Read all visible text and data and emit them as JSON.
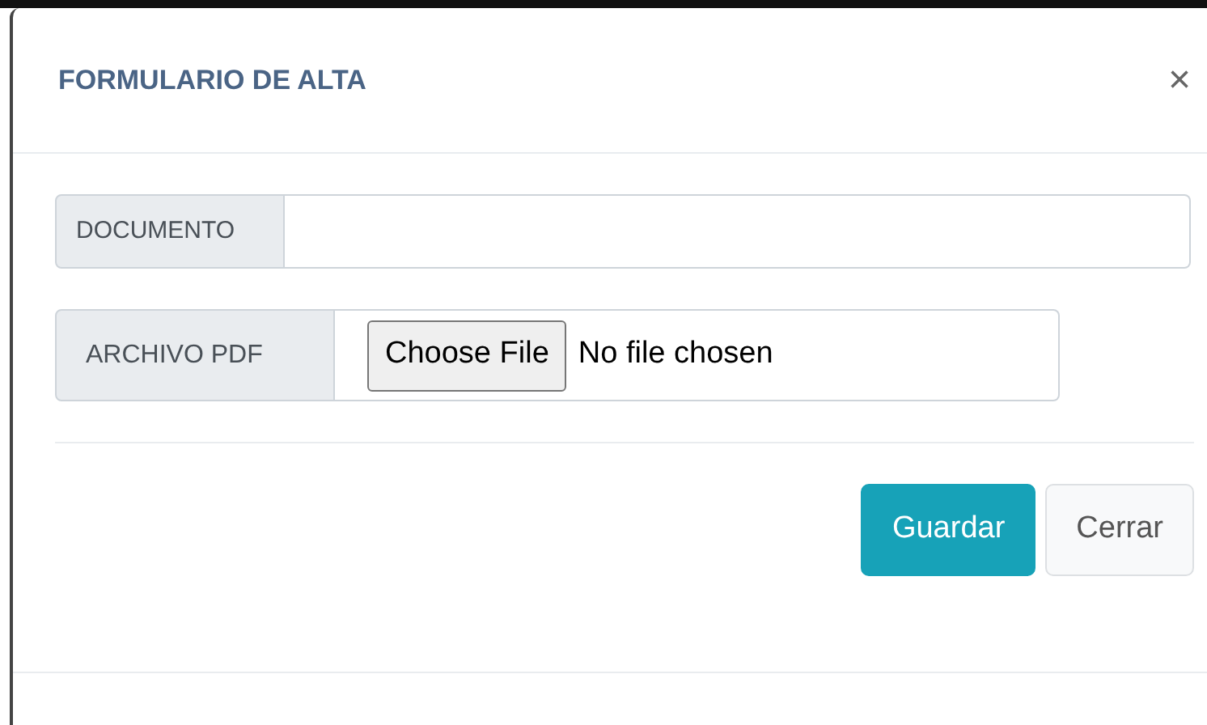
{
  "dialog": {
    "title": "FORMULARIO DE ALTA",
    "close": "×"
  },
  "fields": [
    {
      "kind": "text",
      "label": "DOCUMENTO"
    },
    {
      "kind": "file",
      "label": "ARCHIVO PDF",
      "button": "Choose File",
      "status": "No file chosen"
    }
  ],
  "buttons": [
    {
      "kind": "primary",
      "label": "Guardar"
    },
    {
      "kind": "secondary",
      "label": "Cerrar"
    }
  ]
}
